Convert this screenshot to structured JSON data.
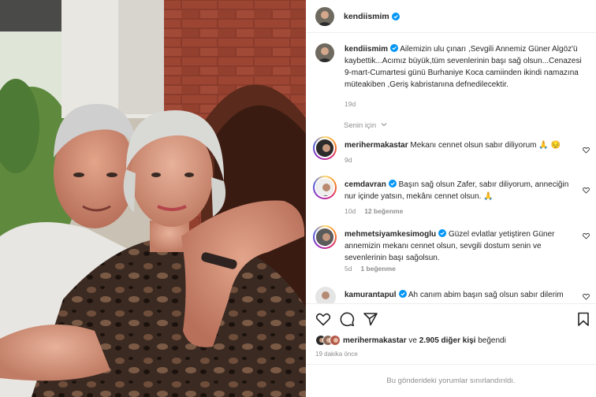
{
  "post": {
    "username": "kendiismim",
    "caption": {
      "username": "kendiismim",
      "text": "Ailemizin ulu çınarı ,Sevgili Annemiz Güner Algöz'ü kaybettik...Acımız büyük,tüm sevenlerinin başı sağ olsun...Cenazesi 9-mart-Cumartesi günü Burhaniye Koca camiinden ikindi namazına müteakiben ,Geriş kabristanına defnedilecektir.",
      "age": "19d"
    },
    "for_you_label": "Senin için"
  },
  "comments": [
    {
      "username": "merihermakastar",
      "text": "Mekanı cennet olsun sabır diliyorum 🙏 😔",
      "age": "9d",
      "likes": ""
    },
    {
      "username": "cemdavran",
      "text": "Başın sağ olsun Zafer, sabır diliyorum, anneciğin nur içinde yatsın, mekânı cennet olsun. 🙏",
      "age": "10d",
      "likes": "12 beğenme"
    },
    {
      "username": "mehmetsiyamkesimoglu",
      "text": "Güzel evlatlar yetiştiren Güner annemizin mekanı cennet olsun, sevgili dostum senin ve sevenlerinin başı sağolsun.",
      "age": "5d",
      "likes": "1 beğenme"
    },
    {
      "username": "kamurantapul",
      "text": "Ah canım abim başın sağ olsun sabır dilerim",
      "age": "",
      "likes": ""
    }
  ],
  "likes": {
    "liker": "merihermakastar",
    "joiner": "ve",
    "others": "2.905 diğer kişi",
    "suffix": "beğendi"
  },
  "timestamp": "19 dakika önce",
  "comments_limited": "Bu gönderideki yorumlar sınırlandırıldı.",
  "icons": [
    "verified-badge-icon",
    "heart-icon",
    "chevron-down-icon",
    "comment-icon",
    "share-icon",
    "bookmark-icon"
  ],
  "colors": {
    "verified": "#0095f6",
    "text": "#262626",
    "muted": "#8e8e8e",
    "divider": "#efefef"
  }
}
